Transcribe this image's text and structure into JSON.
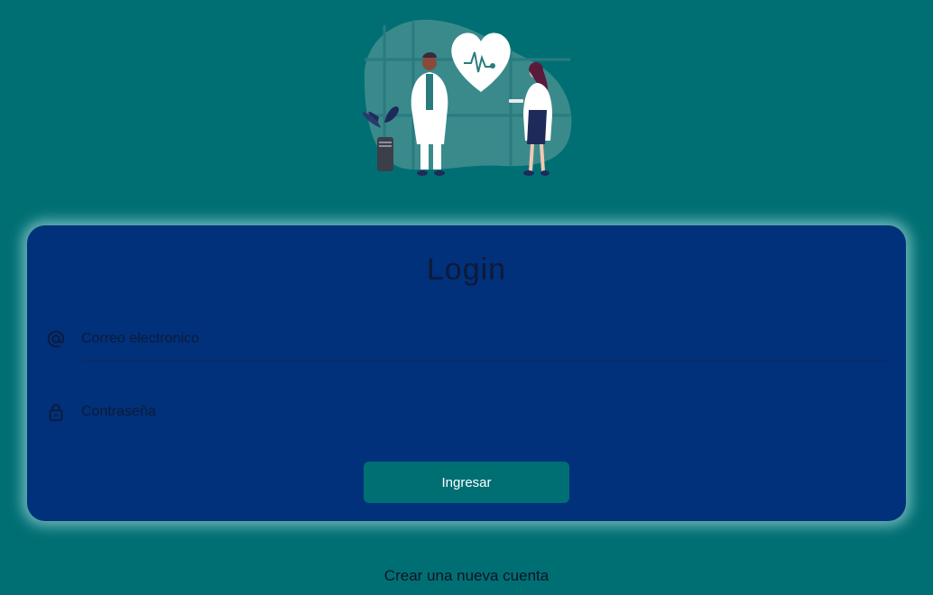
{
  "login": {
    "title": "Login",
    "email": {
      "placeholder": "Correo electronico",
      "icon": "at-icon"
    },
    "password": {
      "placeholder": "Contraseña",
      "icon": "lock-icon"
    },
    "submit_label": "Ingresar"
  },
  "footer": {
    "register_link": "Crear una nueva cuenta"
  },
  "illustration": {
    "icon": "doctors-heart-illustration"
  },
  "colors": {
    "background": "#006f74",
    "card": "#00317a",
    "button": "#006f74",
    "text_dark": "#0d1a3a"
  }
}
